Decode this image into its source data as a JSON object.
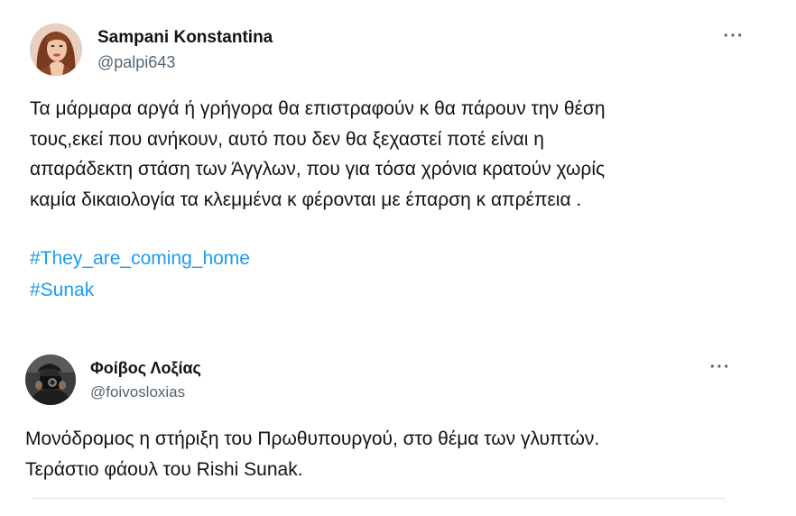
{
  "tweets": [
    {
      "display_name": "Sampani Konstantina",
      "handle": "@palpi643",
      "more_label": "···",
      "text_lines": [
        "Τα μάρμαρα αργά ή γρήγορα θα επιστραφούν κ θα πάρουν την θέση",
        "τους,εκεί που ανήκουν, αυτό που δεν θα ξεχαστεί ποτέ είναι η",
        "απαράδεκτη στάση των Άγγλων, που για τόσα χρόνια κρατούν χωρίς",
        "καμία δικαιολογία τα κλεμμένα κ φέρονται με έπαρση κ απρέπεια ."
      ],
      "hashtags": [
        "#They_are_coming_home",
        "#Sunak"
      ]
    },
    {
      "display_name": "Φοίβος Λοξίας",
      "handle": "@foivosloxias",
      "more_label": "···",
      "text_lines": [
        "Μονόδρομος η στήριξη του Πρωθυπουργού, στο θέμα των γλυπτών.",
        "Τεράστιο φάουλ του Rishi Sunak."
      ]
    }
  ],
  "colors": {
    "text": "#0f1419",
    "secondary": "#536471",
    "hashtag": "#1d9bf0",
    "divider": "#eff3f4"
  },
  "icons": {
    "avatar_1": "woman-profile-photo",
    "avatar_2": "man-profile-photo-with-camera",
    "more": "more-horizontal-icon"
  }
}
